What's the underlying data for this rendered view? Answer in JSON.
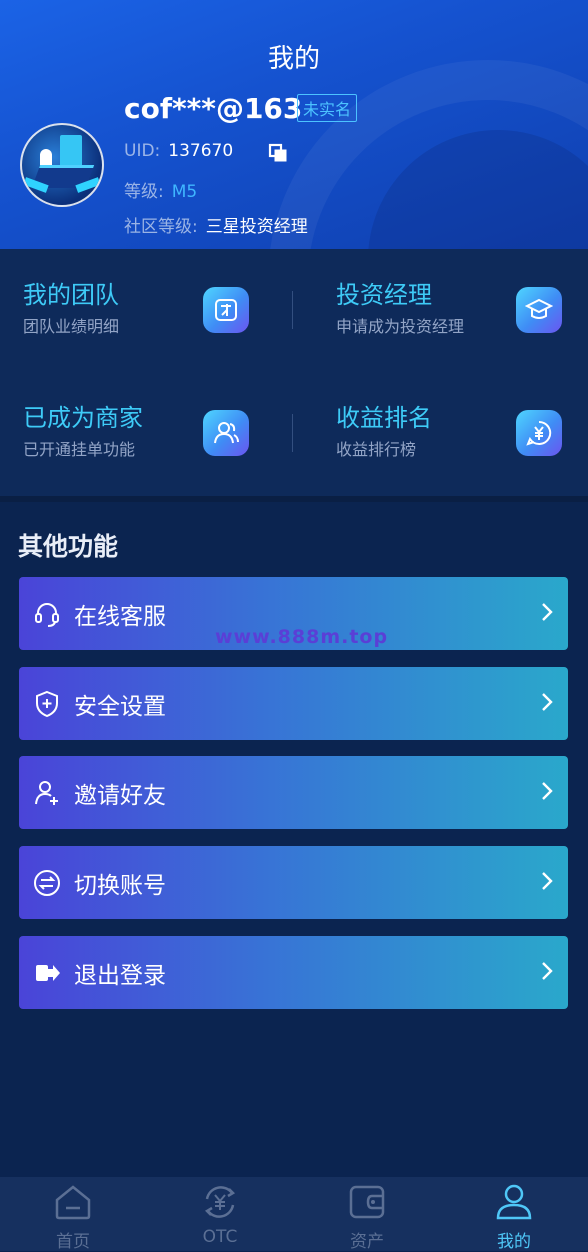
{
  "header": {
    "title": "我的",
    "username": "cof***@163",
    "verify_badge": "未实名",
    "uid_label": "UID:",
    "uid_value": "137670",
    "level_label": "等级:",
    "level_value": "M5",
    "community_label": "社区等级:",
    "community_value": "三星投资经理"
  },
  "grid": [
    {
      "title": "我的团队",
      "subtitle": "团队业绩明细",
      "icon": "team-icon"
    },
    {
      "title": "投资经理",
      "subtitle": "申请成为投资经理",
      "icon": "graduation-cap-icon"
    },
    {
      "title": "已成为商家",
      "subtitle": "已开通挂单功能",
      "icon": "merchant-users-icon"
    },
    {
      "title": "收益排名",
      "subtitle": "收益排行榜",
      "icon": "yen-ranking-icon"
    }
  ],
  "other_section": {
    "title": "其他功能",
    "items": [
      {
        "label": "在线客服",
        "icon": "headset-icon"
      },
      {
        "label": "安全设置",
        "icon": "shield-icon"
      },
      {
        "label": "邀请好友",
        "icon": "add-user-icon"
      },
      {
        "label": "切换账号",
        "icon": "switch-icon"
      },
      {
        "label": "退出登录",
        "icon": "logout-icon"
      }
    ]
  },
  "watermark": "www.888m.top",
  "tabbar": {
    "items": [
      {
        "label": "首页",
        "icon": "home-icon"
      },
      {
        "label": "OTC",
        "icon": "otc-exchange-icon"
      },
      {
        "label": "资产",
        "icon": "wallet-icon"
      },
      {
        "label": "我的",
        "icon": "profile-icon"
      }
    ],
    "active": "我的"
  },
  "colors": {
    "accent_cyan": "#3ecbf7",
    "level_blue": "#3fb6ff",
    "background": "#0b2450",
    "menu_gradient_start": "#4a44d8",
    "menu_gradient_end": "#2aa8cb"
  }
}
